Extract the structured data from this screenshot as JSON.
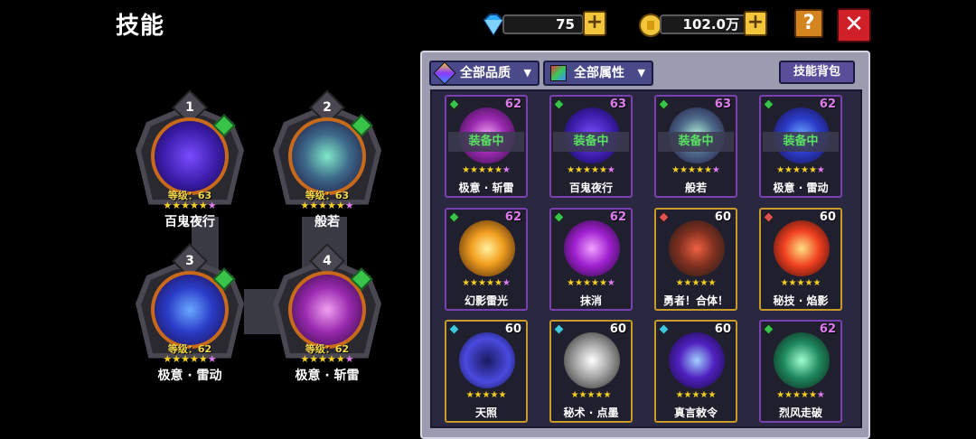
{
  "title": "技能",
  "currency": {
    "gems": {
      "icon": "blue-diamond-icon",
      "value": "75"
    },
    "gold": {
      "icon": "gold-coin-icon",
      "value": "102.0万"
    }
  },
  "buttons": {
    "plus": "+",
    "help": "?",
    "close": "✕"
  },
  "equipped": [
    {
      "num": "1",
      "level": "等级：63",
      "name": "百鬼夜行",
      "stars": 5,
      "purple_star": true
    },
    {
      "num": "2",
      "level": "等级：63",
      "name": "般若",
      "stars": 5,
      "purple_star": true
    },
    {
      "num": "3",
      "level": "等级：62",
      "name": "极意 · 雷动",
      "stars": 5,
      "purple_star": true
    },
    {
      "num": "4",
      "level": "等级：62",
      "name": "极意 · 斩雷",
      "stars": 5,
      "purple_star": true
    }
  ],
  "filters": {
    "quality": "全部品质",
    "attribute": "全部属性",
    "bag": "技能背包"
  },
  "equipped_label": "装备中",
  "skills": [
    {
      "name": "极意 · 斩雷",
      "level": "62",
      "equipped": true,
      "gem": "#38c44a",
      "rarity": "purple",
      "stars": "★★★★★",
      "extra": "★"
    },
    {
      "name": "百鬼夜行",
      "level": "63",
      "equipped": true,
      "gem": "#38c44a",
      "rarity": "purple",
      "stars": "★★★★★",
      "extra": "★"
    },
    {
      "name": "般若",
      "level": "63",
      "equipped": true,
      "gem": "#38c44a",
      "rarity": "purple",
      "stars": "★★★★★",
      "extra": "★"
    },
    {
      "name": "极意 · 雷动",
      "level": "62",
      "equipped": true,
      "gem": "#38c44a",
      "rarity": "purple",
      "stars": "★★★★★",
      "extra": "★"
    },
    {
      "name": "幻影雷光",
      "level": "62",
      "equipped": false,
      "gem": "#38c44a",
      "rarity": "purple",
      "stars": "★★★★★",
      "extra": "★"
    },
    {
      "name": "抹消",
      "level": "62",
      "equipped": false,
      "gem": "#38c44a",
      "rarity": "purple",
      "stars": "★★★★★",
      "extra": "★"
    },
    {
      "name": "勇者！合体！",
      "level": "60",
      "equipped": false,
      "gem": "#e05050",
      "rarity": "gold",
      "stars": "★★★★★",
      "extra": ""
    },
    {
      "name": "秘技 · 焰影",
      "level": "60",
      "equipped": false,
      "gem": "#e05050",
      "rarity": "gold",
      "stars": "★★★★★",
      "extra": ""
    },
    {
      "name": "天照",
      "level": "60",
      "equipped": false,
      "gem": "#40c8e0",
      "rarity": "gold",
      "stars": "★★★★★",
      "extra": ""
    },
    {
      "name": "秘术 · 点墨",
      "level": "60",
      "equipped": false,
      "gem": "#40c8e0",
      "rarity": "gold",
      "stars": "★★★★★",
      "extra": ""
    },
    {
      "name": "真言敕令",
      "level": "60",
      "equipped": false,
      "gem": "#40c8e0",
      "rarity": "gold",
      "stars": "★★★★★",
      "extra": ""
    },
    {
      "name": "烈风走破",
      "level": "62",
      "equipped": false,
      "gem": "#38c44a",
      "rarity": "purple",
      "stars": "★★★★★",
      "extra": "★"
    }
  ],
  "colors": {
    "accent_gold": "#f2c53a",
    "close_red": "#d0202a",
    "help_orange": "#d4851f",
    "panel": "#9c9cb0"
  }
}
